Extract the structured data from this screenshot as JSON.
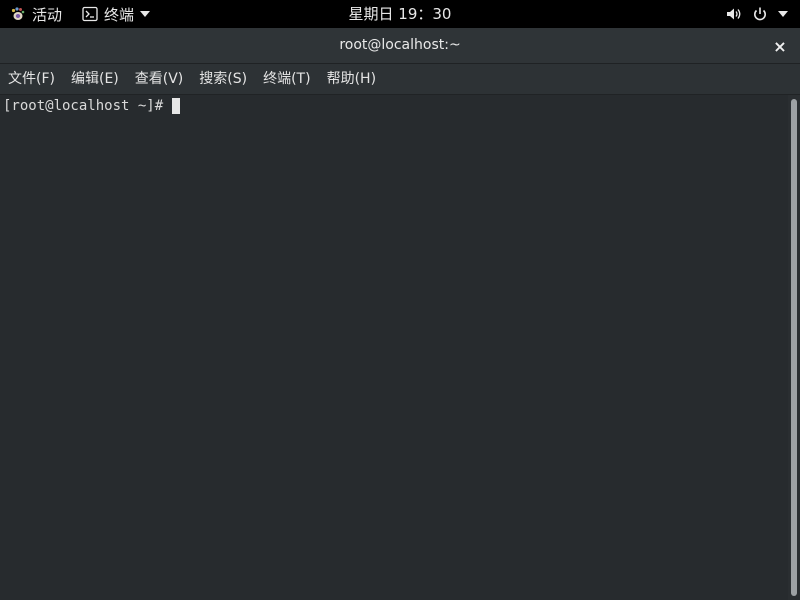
{
  "top_panel": {
    "activities_label": "活动",
    "app_menu_label": "终端",
    "clock": "星期日 19：30",
    "icons": {
      "activities": "gnome-foot-icon",
      "app": "terminal-icon",
      "app_dropdown": "chevron-down-icon",
      "volume": "volume-icon",
      "power": "power-icon",
      "system_menu": "chevron-down-icon"
    }
  },
  "window": {
    "title": "root@localhost:~",
    "close_label": "×",
    "menu": [
      {
        "label": "文件(F)"
      },
      {
        "label": "编辑(E)"
      },
      {
        "label": "查看(V)"
      },
      {
        "label": "搜索(S)"
      },
      {
        "label": "终端(T)"
      },
      {
        "label": "帮助(H)"
      }
    ]
  },
  "terminal": {
    "prompt": "[root@localhost ~]#"
  },
  "colors": {
    "panel_bg": "#000000",
    "titlebar_bg": "#2f3437",
    "terminal_bg": "#272b2e",
    "text": "#d9d9d9"
  }
}
